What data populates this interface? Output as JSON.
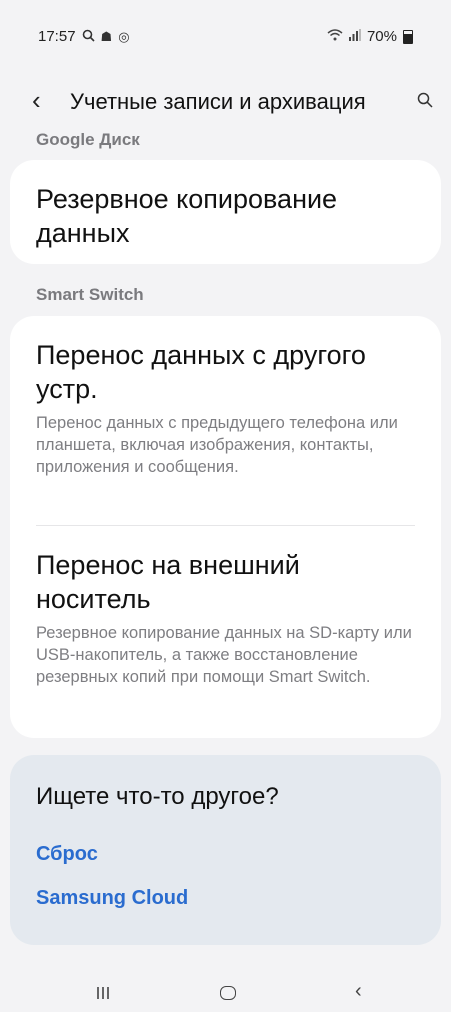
{
  "status": {
    "time": "17:57",
    "battery": "70%",
    "icons_left": [
      "search-icon",
      "notification-icon",
      "sync-icon"
    ],
    "icons_right": [
      "wifi-icon",
      "signal-icon",
      "battery-icon"
    ]
  },
  "header": {
    "title": "Учетные записи и архивация"
  },
  "sections": {
    "google_label": "Google Диск",
    "smart_switch_label": "Smart Switch"
  },
  "google_card": {
    "item1_title_line1": "Резервное копирование",
    "item1_title_line2": "данных"
  },
  "smart_card": {
    "item1_title_line1": "Перенос данных с другого",
    "item1_title_line2": "устр.",
    "item1_desc": "Перенос данных с предыдущего телефона или планшета, включая изображения, контакты, приложения и сообщения.",
    "item2_title_line1": "Перенос на внешний",
    "item2_title_line2": "носитель",
    "item2_desc": "Резервное копирование данных на SD-карту или USB-накопитель, а также восстановление резервных копий при помощи Smart Switch."
  },
  "extra": {
    "title": "Ищете что-то другое?",
    "link1": "Сброс",
    "link2": "Samsung Cloud"
  },
  "colors": {
    "link": "#2a6ccf",
    "background": "#f3f3f5",
    "extra_card": "#e4e9ef"
  }
}
